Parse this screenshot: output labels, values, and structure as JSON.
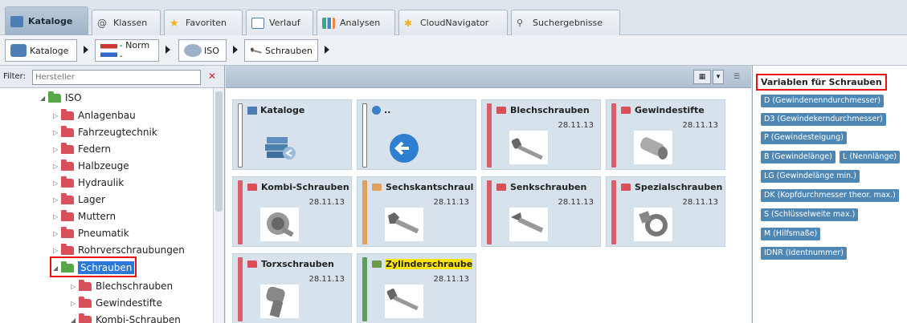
{
  "tabs": [
    {
      "label": "Kataloge",
      "icon": "catalog-icon",
      "active": true
    },
    {
      "label": "Klassen",
      "icon": "at-icon"
    },
    {
      "label": "Favoriten",
      "icon": "star-icon"
    },
    {
      "label": "Verlauf",
      "icon": "calendar-icon"
    },
    {
      "label": "Analysen",
      "icon": "chart-icon"
    },
    {
      "label": "CloudNavigator",
      "icon": "cloud-icon"
    },
    {
      "label": "Suchergebnisse",
      "icon": "search-icon"
    }
  ],
  "breadcrumb": [
    {
      "label": "Kataloge",
      "icon": "catalog-icon"
    },
    {
      "label": "- Norm -",
      "icon": "flags-icon"
    },
    {
      "label": "ISO",
      "icon": "iso-icon"
    },
    {
      "label": "Schrauben",
      "icon": "screw-icon"
    }
  ],
  "filter": {
    "label": "Filter:",
    "placeholder": "Hersteller"
  },
  "tree": {
    "root": "ISO",
    "items": [
      "Anlagenbau",
      "Fahrzeugtechnik",
      "Federn",
      "Halbzeuge",
      "Hydraulik",
      "Lager",
      "Muttern",
      "Pneumatik",
      "Rohrverschraubungen"
    ],
    "selected": "Schrauben",
    "children": [
      "Blechschrauben",
      "Gewindestifte",
      "Kombi-Schrauben"
    ]
  },
  "tiles": [
    {
      "title": "Kataloge",
      "date": "",
      "kind": "nav"
    },
    {
      "title": "..",
      "date": "",
      "kind": "back"
    },
    {
      "title": "Blechschrauben",
      "date": "28.11.13",
      "color": "#d9606a"
    },
    {
      "title": "Gewindestifte",
      "date": "28.11.13",
      "color": "#d9606a"
    },
    {
      "title": "Kombi-Schrauben",
      "date": "28.11.13",
      "color": "#d9606a"
    },
    {
      "title": "Sechskantschraul",
      "date": "28.11.13",
      "color": "#e0a060"
    },
    {
      "title": "Senkschrauben",
      "date": "28.11.13",
      "color": "#d9606a"
    },
    {
      "title": "Spezialschrauben",
      "date": "28.11.13",
      "color": "#d9606a"
    },
    {
      "title": "Torxschrauben",
      "date": "28.11.13",
      "color": "#d9606a"
    },
    {
      "title": "Zylinderschraube",
      "date": "28.11.13",
      "color": "#5aa05a",
      "highlight": true
    }
  ],
  "variables": {
    "title": "Variablen für Schrauben",
    "items": [
      "D (Gewindenenndurchmesser)",
      "D3 (Gewindekerndurchmesser)",
      "P (Gewindesteigung)",
      "B (Gewindelänge)",
      "L (Nennlänge)",
      "LG (Gewindelänge min.)",
      "DK (Kopfdurchmesser theor. max.)",
      "S (Schlüsselweite max.)",
      "M (Hilfsmaße)",
      "IDNR (Identnummer)"
    ]
  }
}
